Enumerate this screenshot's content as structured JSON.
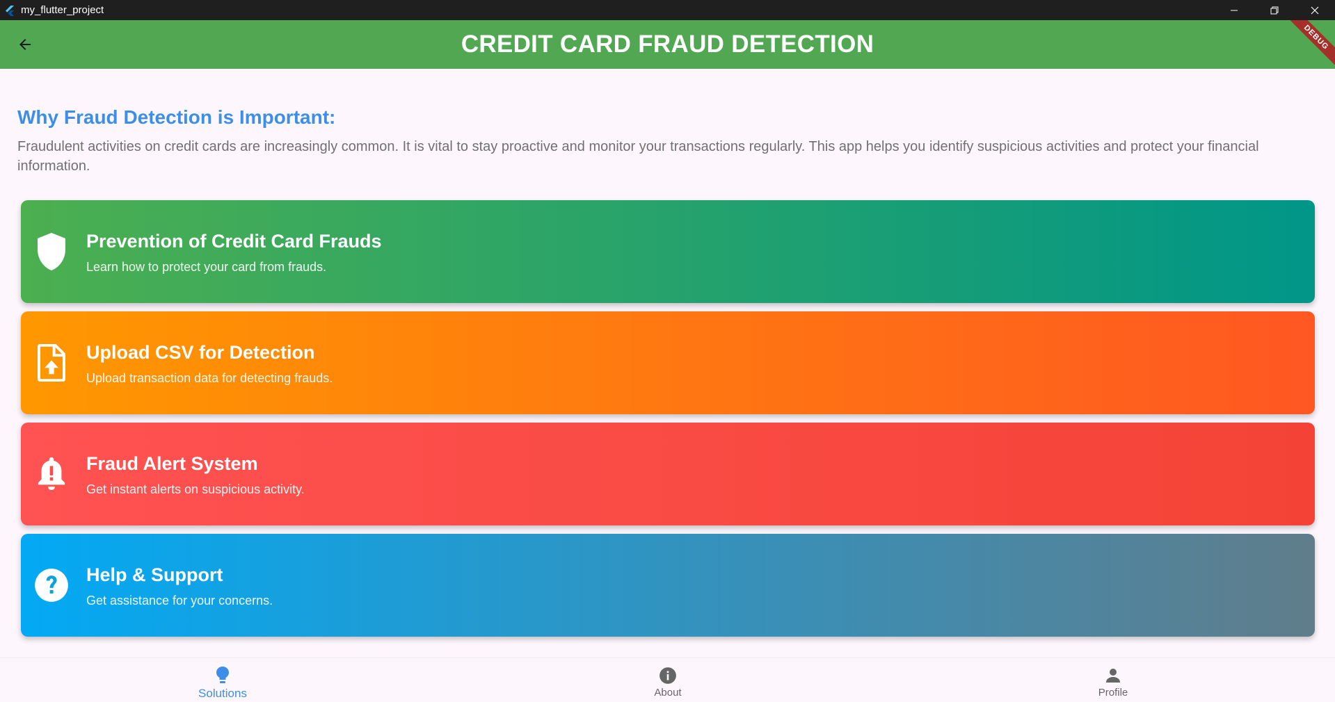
{
  "window": {
    "title": "my_flutter_project"
  },
  "appbar": {
    "title": "CREDIT CARD FRAUD DETECTION",
    "debug_label": "DEBUG"
  },
  "intro": {
    "heading": "Why Fraud Detection is Important:",
    "text": "Fraudulent activities on credit cards are increasingly common. It is vital to stay proactive and monitor your transactions regularly. This app helps you identify suspicious activities and protect your financial information."
  },
  "cards": [
    {
      "title": "Prevention of Credit Card Frauds",
      "subtitle": "Learn how to protect your card from frauds.",
      "icon": "shield-icon"
    },
    {
      "title": "Upload CSV for Detection",
      "subtitle": "Upload transaction data for detecting frauds.",
      "icon": "upload-file-icon"
    },
    {
      "title": "Fraud Alert System",
      "subtitle": "Get instant alerts on suspicious activity.",
      "icon": "alert-bell-icon"
    },
    {
      "title": "Help & Support",
      "subtitle": "Get assistance for your concerns.",
      "icon": "help-icon"
    }
  ],
  "bottom_nav": {
    "items": [
      {
        "label": "Solutions",
        "icon": "lightbulb-icon",
        "active": true
      },
      {
        "label": "About",
        "icon": "info-icon",
        "active": false
      },
      {
        "label": "Profile",
        "icon": "person-icon",
        "active": false
      }
    ]
  },
  "colors": {
    "appbar": "#52a852",
    "accent": "#3d8ee8"
  }
}
